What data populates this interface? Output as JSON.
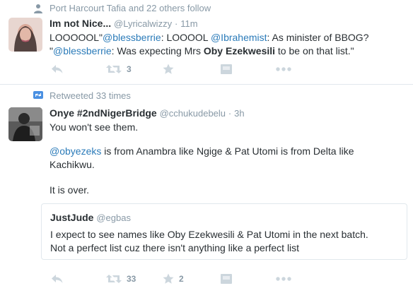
{
  "tweets": [
    {
      "context": "Port Harcourt Tafia and 22 others follow",
      "fullname": "Im not Nice...",
      "username": "@Lyricalwizzy",
      "separator": "·",
      "time": "11m",
      "text_parts": {
        "p1": "LOOOOOL\"",
        "m1": "@blessberrie",
        "p2": ": LOOOOL ",
        "m2": "@Ibrahemist",
        "p3": ": As minister of BBOG?",
        "p4": "\"",
        "m3": "@blessberrie",
        "p5": ": Was expecting Mrs ",
        "b1": "Oby Ezekwesili",
        "p6": " to be on that list.\""
      },
      "retweet_count": "3",
      "like_count": ""
    },
    {
      "context": "Retweeted 33 times",
      "fullname": "Onye #2ndNigerBridge",
      "username": "@cchukudebelu",
      "separator": "·",
      "time": "3h",
      "line1": "You won't see them.",
      "mention": "@obyezeks",
      "line2a": " is from Anambra like Ngige & Pat Utomi is from Delta like",
      "line2b": "Kachikwu.",
      "line3": "It is over.",
      "quote": {
        "fullname": "JustJude",
        "username": "@egbas",
        "line1": "I expect to see names like Oby Ezekwesili & Pat Utomi in the next batch.",
        "line2": "Not a perfect list cuz there isn't anything like a perfect list"
      },
      "retweet_count": "33",
      "like_count": "2"
    }
  ],
  "colors": {
    "link": "#2b7bb9",
    "muted": "#8899a6",
    "icon": "#ccd6dd",
    "retweet_context_icon": "#4a90e2"
  }
}
